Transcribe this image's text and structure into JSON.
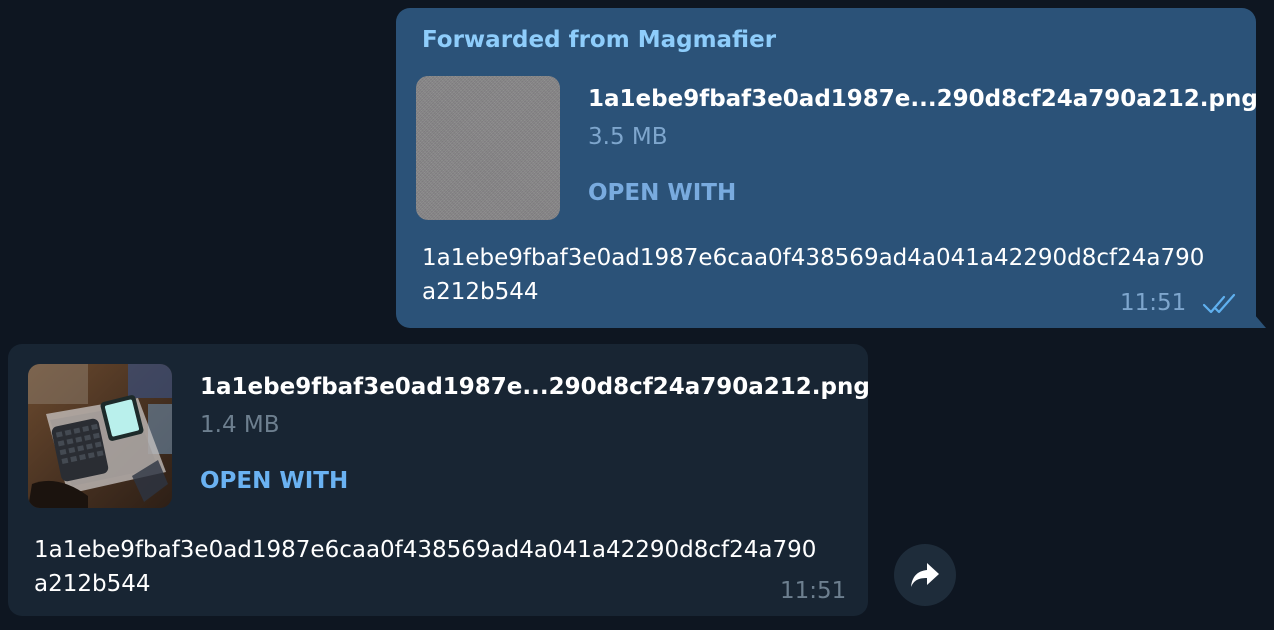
{
  "messages": [
    {
      "direction": "outgoing",
      "forwarded_from": "Forwarded from Magmafier",
      "file_name": "1a1ebe9fbaf3e0ad1987e...290d8cf24a790a212.png",
      "file_size": "3.5 MB",
      "action_label": "OPEN WITH",
      "caption_lines": [
        "1a1ebe9fbaf3e0ad1987e6caa0f438569ad4a041a42290d8cf24a790",
        "a212b544"
      ],
      "time": "11:51",
      "status_icon": "double-check-icon"
    },
    {
      "direction": "incoming",
      "file_name": "1a1ebe9fbaf3e0ad1987e...290d8cf24a790a212.png",
      "file_size": "1.4 MB",
      "action_label": "OPEN WITH",
      "caption_lines": [
        "1a1ebe9fbaf3e0ad1987e6caa0f438569ad4a041a42290d8cf24a790",
        "a212b544"
      ],
      "time": "11:51"
    }
  ],
  "share_button": {
    "icon": "share-arrow-icon"
  },
  "colors": {
    "background": "#0e1621",
    "outgoing_bubble": "#2b5278",
    "incoming_bubble": "#182533",
    "forwarded_text": "#8ecdfb",
    "link_accent": "#6ab2f2"
  }
}
